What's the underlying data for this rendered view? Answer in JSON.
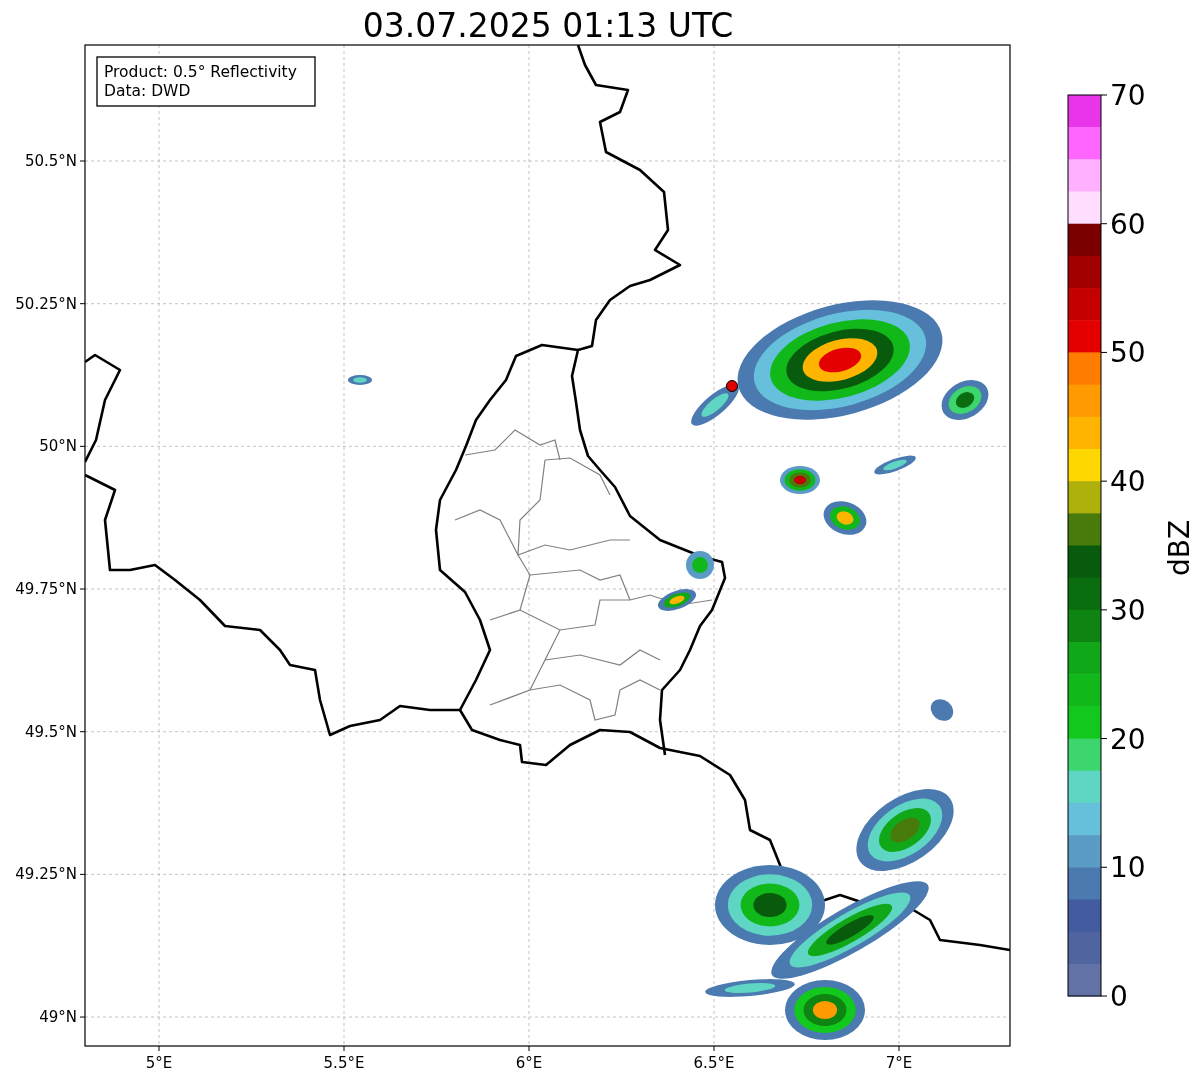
{
  "title": "03.07.2025 01:13 UTC",
  "info_box": {
    "lines": [
      "Product: 0.5° Reflectivity",
      "Data: DWD"
    ]
  },
  "map": {
    "xticks": [
      "5°E",
      "5.5°E",
      "6°E",
      "6.5°E",
      "7°E"
    ],
    "yticks": [
      "50.5°N",
      "50.25°N",
      "50°N",
      "49.75°N",
      "49.5°N",
      "49.25°N",
      "49°N"
    ]
  },
  "colorbar": {
    "label": "dBZ",
    "ticks": [
      "70",
      "60",
      "50",
      "40",
      "30",
      "20",
      "10",
      "0"
    ],
    "segments": [
      {
        "color": "#e935e9"
      },
      {
        "color": "#ff66ff"
      },
      {
        "color": "#ffb0ff"
      },
      {
        "color": "#ffddff"
      },
      {
        "color": "#7a0000"
      },
      {
        "color": "#a20000"
      },
      {
        "color": "#c40000"
      },
      {
        "color": "#e40000"
      },
      {
        "color": "#ff7c00"
      },
      {
        "color": "#ff9a00"
      },
      {
        "color": "#ffb400"
      },
      {
        "color": "#ffd700"
      },
      {
        "color": "#b0b00a"
      },
      {
        "color": "#487a0c"
      },
      {
        "color": "#085a0c"
      },
      {
        "color": "#0a6e10"
      },
      {
        "color": "#0e8412"
      },
      {
        "color": "#10a818"
      },
      {
        "color": "#10b81a"
      },
      {
        "color": "#12c81c"
      },
      {
        "color": "#3dd66e"
      },
      {
        "color": "#5fd6c4"
      },
      {
        "color": "#66c0dc"
      },
      {
        "color": "#5a9cc6"
      },
      {
        "color": "#4a7ab0"
      },
      {
        "color": "#425c9f"
      },
      {
        "color": "#50649f"
      },
      {
        "color": "#6272a6"
      }
    ]
  }
}
